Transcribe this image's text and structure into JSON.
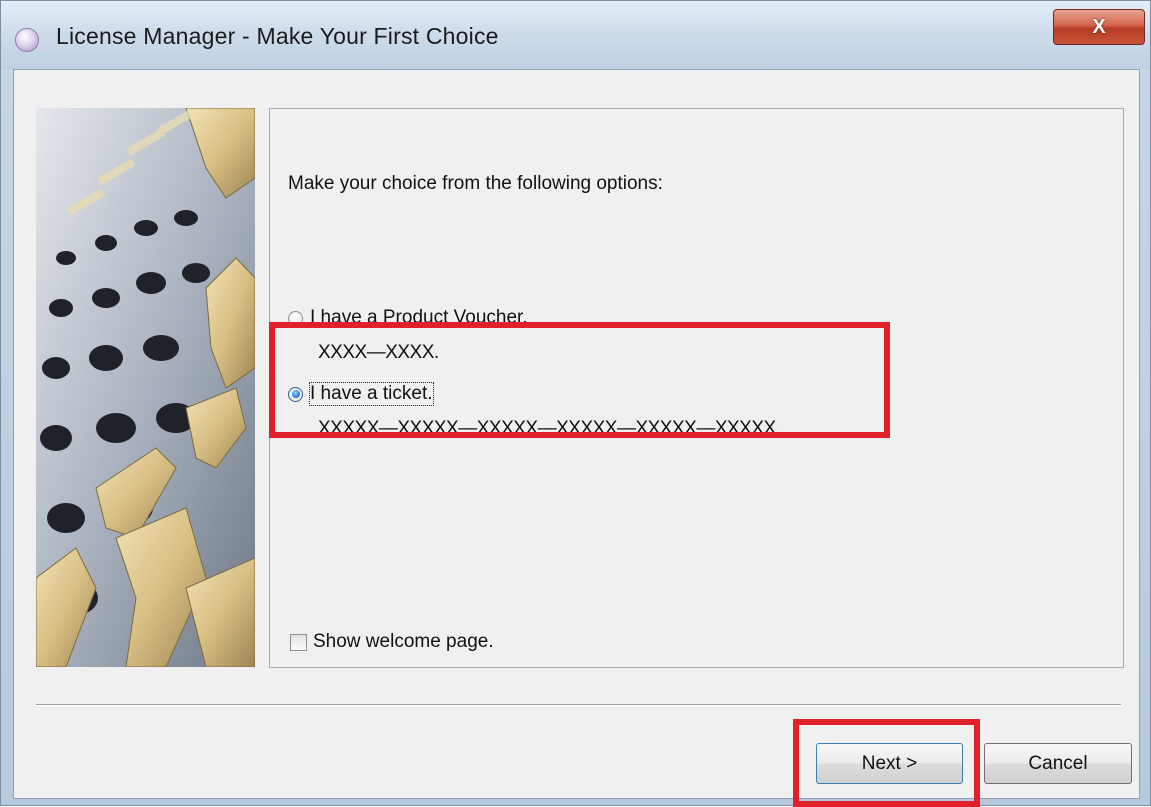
{
  "window": {
    "title": "License Manager -  Make Your First Choice",
    "close_glyph": "X"
  },
  "content": {
    "prompt": "Make your choice from the following options:",
    "options": [
      {
        "label": "I have a Product Voucher.",
        "format": "XXXX—XXXX.",
        "selected": false
      },
      {
        "label": "I have a ticket.",
        "format": "XXXXX—XXXXX—XXXXX—XXXXX—XXXXX—XXXXX.",
        "selected": true
      }
    ],
    "show_welcome_label": "Show welcome page.",
    "show_welcome_checked": false
  },
  "buttons": {
    "next": "Next >",
    "cancel": "Cancel"
  },
  "colors": {
    "highlight": "#e0202a",
    "close_button": "#c7553b"
  }
}
